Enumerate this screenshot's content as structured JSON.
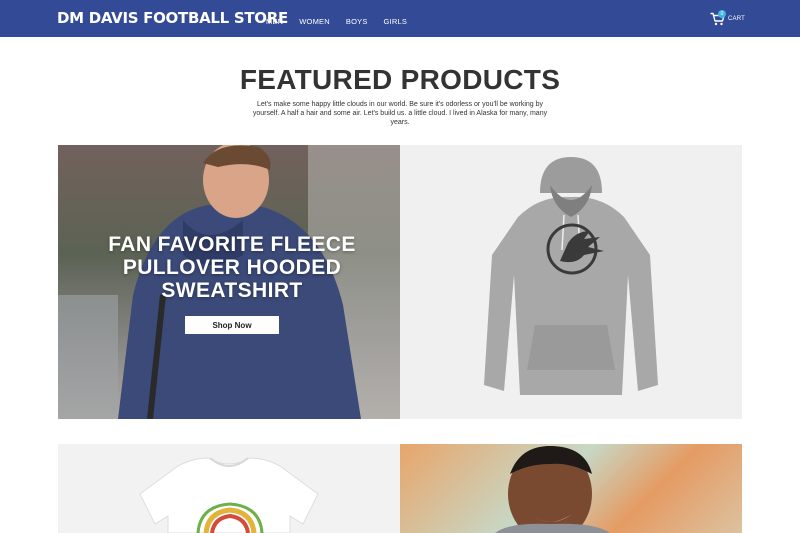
{
  "header": {
    "brand": "DM DAVIS FOOTBALL STORE",
    "nav": [
      "MEN",
      "WOMEN",
      "BOYS",
      "GIRLS"
    ],
    "cart_label": "CART",
    "cart_count": "0"
  },
  "featured": {
    "title": "FEATURED PRODUCTS",
    "description": "Let's make some happy little clouds in our world. Be sure it's odorless or you'll be working by yourself. A half a hair and some air. Let's build us. a little cloud. I lived in Alaska for many, many years."
  },
  "hero": {
    "title": "FAN FAVORITE FLEECE PULLOVER HOODED SWEATSHIRT",
    "button_label": "Shop Now"
  },
  "colors": {
    "header_bg": "#334a97",
    "cart_badge": "#3fb6e0",
    "hoodie_gray": "#a6a6a6",
    "logo_dark": "#3a3a3a"
  },
  "icons": {
    "cart": "shopping-cart-icon",
    "hoodie": "hoodie-product-image",
    "tshirt": "tshirt-product-image"
  }
}
